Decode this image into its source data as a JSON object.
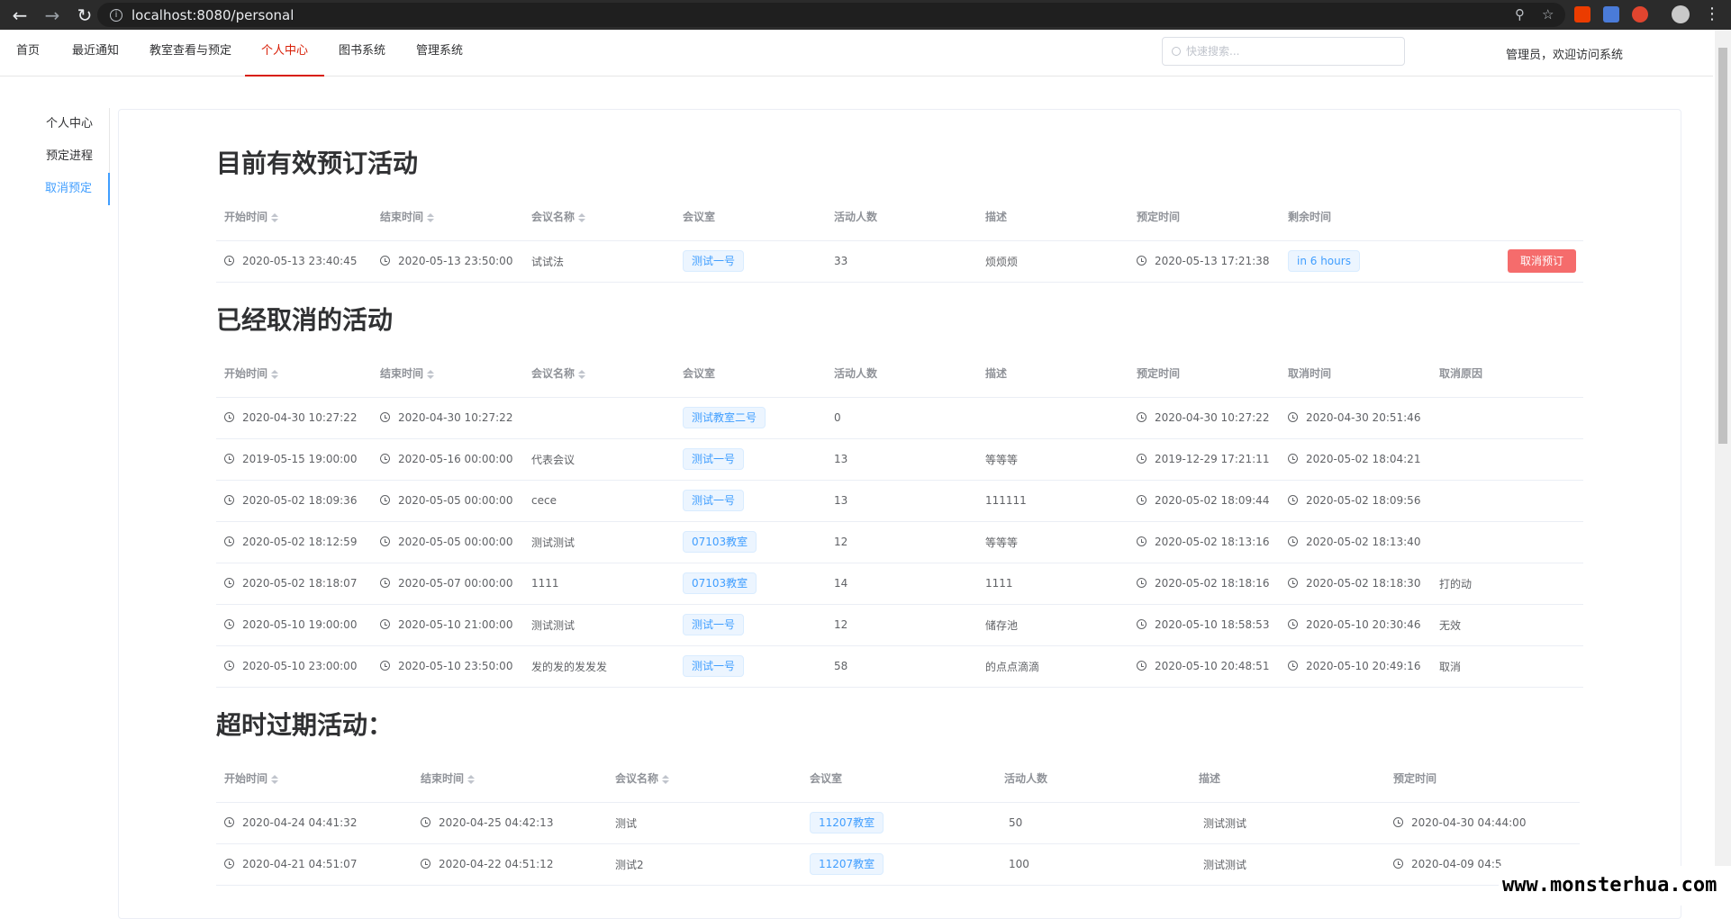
{
  "browser": {
    "url": "localhost:8080/personal"
  },
  "topnav": {
    "items": [
      "首页",
      "最近通知",
      "教室查看与预定",
      "个人中心",
      "图书系统",
      "管理系统"
    ],
    "active_index": 3,
    "search_placeholder": "快速搜索...",
    "welcome": "管理员，欢迎访问系统"
  },
  "sidebar": {
    "items": [
      "个人中心",
      "预定进程",
      "取消预定"
    ],
    "active_index": 2
  },
  "active": {
    "title": "目前有效预订活动",
    "headers": [
      "开始时间",
      "结束时间",
      "会议名称",
      "会议室",
      "活动人数",
      "描述",
      "预定时间",
      "剩余时间"
    ],
    "rows": [
      {
        "start": "2020-05-13 23:40:45",
        "end": "2020-05-13 23:50:00",
        "name": "试试法",
        "room": "测试一号",
        "people": "33",
        "desc": "烦烦烦",
        "booked": "2020-05-13 17:21:38",
        "remain": "in 6 hours",
        "action": "取消预订"
      }
    ]
  },
  "cancelled": {
    "title": "已经取消的活动",
    "headers": [
      "开始时间",
      "结束时间",
      "会议名称",
      "会议室",
      "活动人数",
      "描述",
      "预定时间",
      "取消时间",
      "取消原因"
    ],
    "rows": [
      {
        "start": "2020-04-30 10:27:22",
        "end": "2020-04-30 10:27:22",
        "name": "",
        "room": "测试教室二号",
        "people": "0",
        "desc": "",
        "booked": "2020-04-30 10:27:22",
        "cancel": "2020-04-30 20:51:46",
        "reason": ""
      },
      {
        "start": "2019-05-15 19:00:00",
        "end": "2020-05-16 00:00:00",
        "name": "代表会议",
        "room": "测试一号",
        "people": "13",
        "desc": "等等等",
        "booked": "2019-12-29 17:21:11",
        "cancel": "2020-05-02 18:04:21",
        "reason": ""
      },
      {
        "start": "2020-05-02 18:09:36",
        "end": "2020-05-05 00:00:00",
        "name": "cece",
        "room": "测试一号",
        "people": "13",
        "desc": "111111",
        "booked": "2020-05-02 18:09:44",
        "cancel": "2020-05-02 18:09:56",
        "reason": ""
      },
      {
        "start": "2020-05-02 18:12:59",
        "end": "2020-05-05 00:00:00",
        "name": "测试测试",
        "room": "07103教室",
        "people": "12",
        "desc": "等等等",
        "booked": "2020-05-02 18:13:16",
        "cancel": "2020-05-02 18:13:40",
        "reason": ""
      },
      {
        "start": "2020-05-02 18:18:07",
        "end": "2020-05-07 00:00:00",
        "name": "1111",
        "room": "07103教室",
        "people": "14",
        "desc": "1111",
        "booked": "2020-05-02 18:18:16",
        "cancel": "2020-05-02 18:18:30",
        "reason": "打的动"
      },
      {
        "start": "2020-05-10 19:00:00",
        "end": "2020-05-10 21:00:00",
        "name": "测试测试",
        "room": "测试一号",
        "people": "12",
        "desc": "储存池",
        "booked": "2020-05-10 18:58:53",
        "cancel": "2020-05-10 20:30:46",
        "reason": "无效"
      },
      {
        "start": "2020-05-10 23:00:00",
        "end": "2020-05-10 23:50:00",
        "name": "发的发的发发发",
        "room": "测试一号",
        "people": "58",
        "desc": "的点点滴滴",
        "booked": "2020-05-10 20:48:51",
        "cancel": "2020-05-10 20:49:16",
        "reason": "取消"
      }
    ]
  },
  "expired": {
    "title": "超时过期活动：",
    "headers": [
      "开始时间",
      "结束时间",
      "会议名称",
      "会议室",
      "活动人数",
      "描述",
      "预定时间"
    ],
    "rows": [
      {
        "start": "2020-04-24 04:41:32",
        "end": "2020-04-25 04:42:13",
        "name": "测试",
        "room": "11207教室",
        "people": "50",
        "desc": "测试测试",
        "booked": "2020-04-30 04:44:00"
      },
      {
        "start": "2020-04-21 04:51:07",
        "end": "2020-04-22 04:51:12",
        "name": "测试2",
        "room": "11207教室",
        "people": "100",
        "desc": "测试测试",
        "booked": "2020-04-09 04:5"
      }
    ]
  },
  "watermark": "www.monsterhua.com"
}
